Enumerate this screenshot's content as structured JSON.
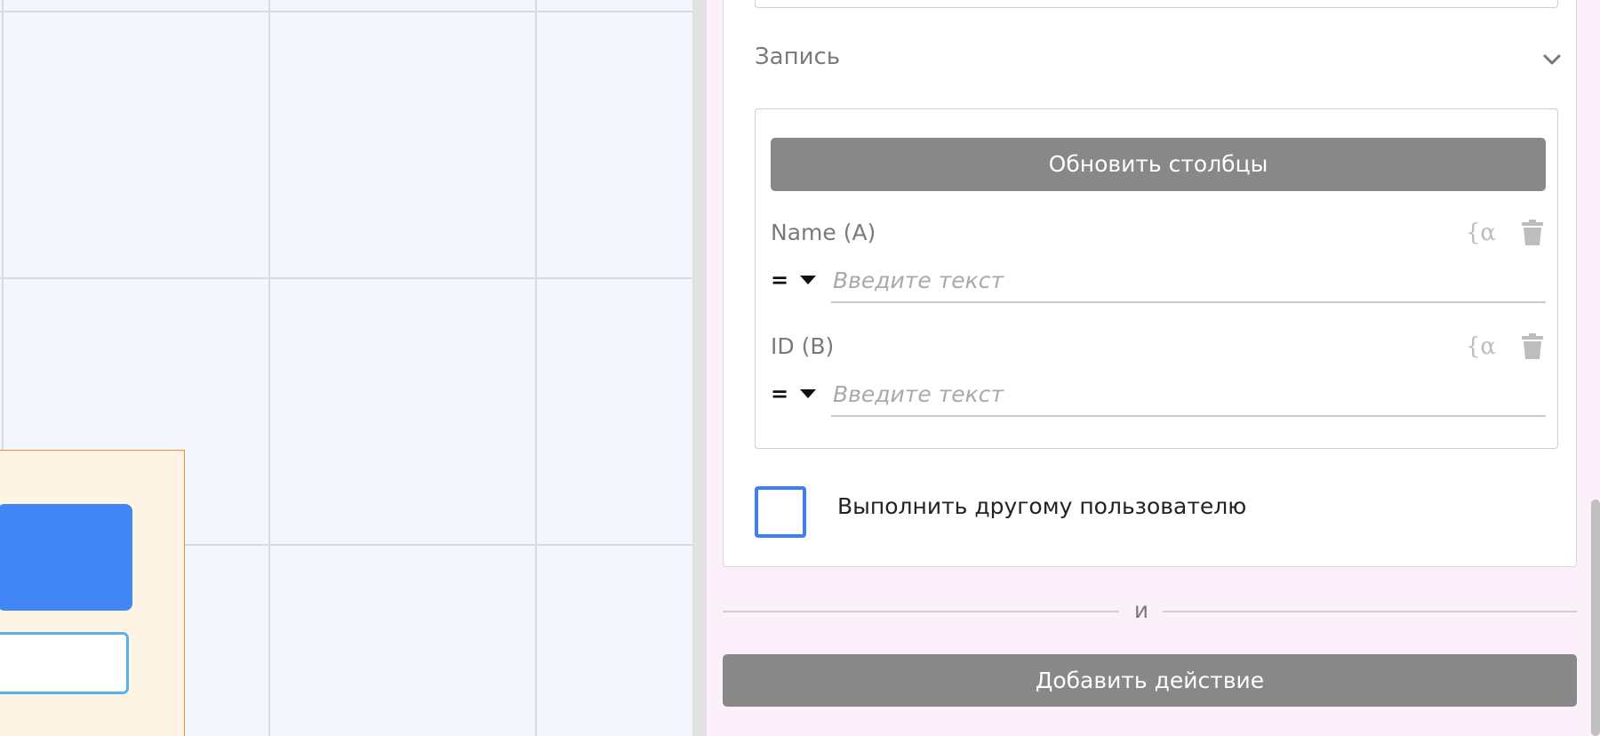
{
  "record_section": {
    "title": "Запись",
    "update_columns_label": "Обновить столбцы",
    "fields": [
      {
        "label": "Name (A)",
        "operator": "=",
        "placeholder": "Введите текст",
        "variable_icon": "{α"
      },
      {
        "label": "ID (B)",
        "operator": "=",
        "placeholder": "Введите текст",
        "variable_icon": "{α"
      }
    ]
  },
  "run_as_other_user": {
    "label": "Выполнить другому пользователю",
    "checked": false
  },
  "divider": {
    "text": "и"
  },
  "add_action_label": "Добавить действие",
  "colors": {
    "canvas_background": "#f3f7fd",
    "panel_background": "#fcf0fa",
    "button_gray": "#888888",
    "checkbox_border": "#3d7ff2",
    "widget_button": "#4287f5",
    "widget_border": "#f0902c"
  },
  "icons": {
    "collapse": "chevron-down-icon",
    "variable": "variable-icon",
    "delete": "trash-icon",
    "operator_dropdown": "caret-down-icon"
  }
}
